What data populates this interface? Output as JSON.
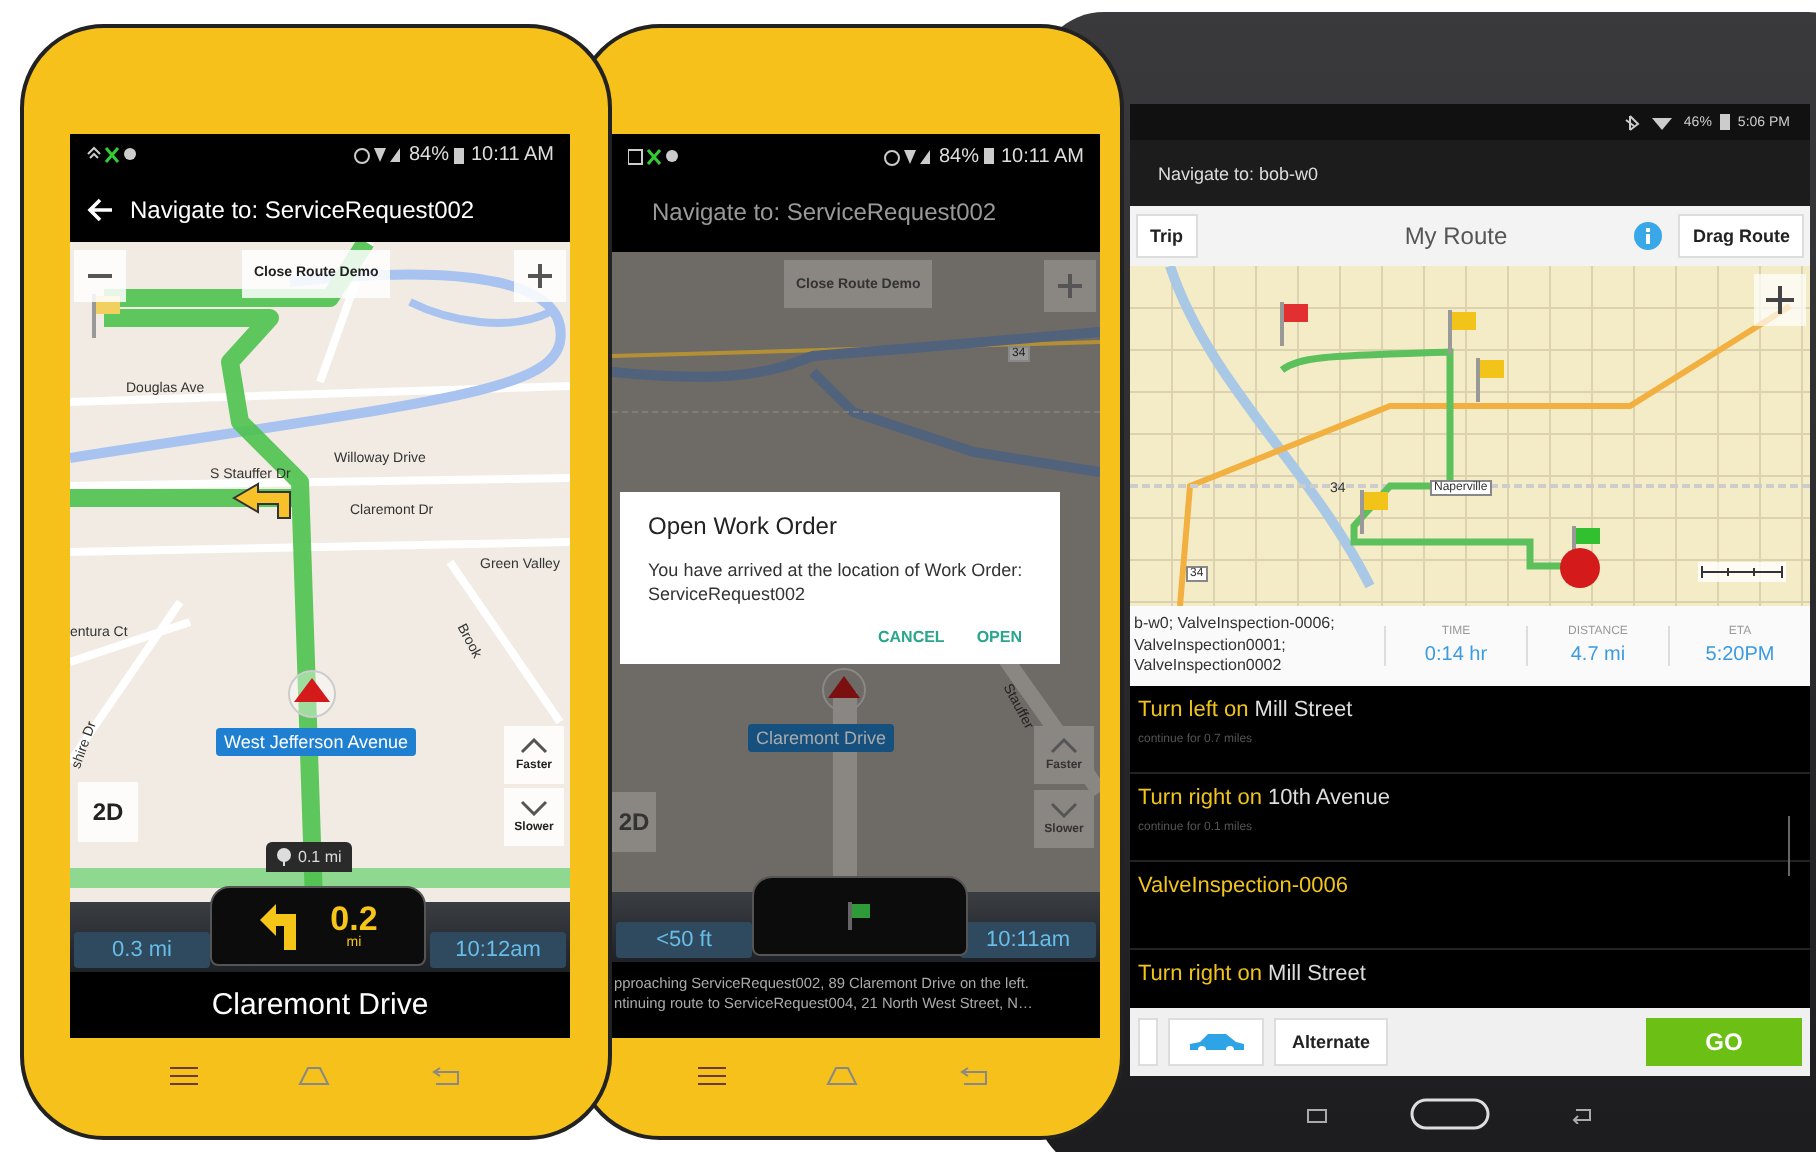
{
  "phone_navigation": {
    "status": {
      "battery": "84%",
      "time": "10:11 AM"
    },
    "title": "Navigate to: ServiceRequest002",
    "map": {
      "close_button": "Close Route Demo",
      "labels": [
        "Douglas Ave",
        "Willoway Drive",
        "S Stauffer Dr",
        "Claremont Dr",
        "Green Valley",
        "entura Ct",
        "Brook",
        "shire Dr"
      ],
      "vehicle_label": "West Jefferson Avenue",
      "speed_buttons": [
        "Faster",
        "Slower"
      ],
      "view_button": "2D",
      "distance_tag": "0.1 mi"
    },
    "dashboard": {
      "left": "0.3 mi",
      "turn_distance": "0.2",
      "turn_unit": "mi",
      "right": "10:12am"
    },
    "street": "Claremont Drive"
  },
  "phone_arrival": {
    "status": {
      "battery": "84%",
      "time": "10:11 AM"
    },
    "title": "Navigate to: ServiceRequest002",
    "map": {
      "close_button": "Close Route Demo",
      "labels": [
        "34",
        "Stauffer"
      ],
      "vehicle_label": "Claremont Drive",
      "speed_buttons": [
        "Faster",
        "Slower"
      ],
      "view_button": "2D"
    },
    "dialog": {
      "title": "Open Work Order",
      "message": "You have arrived at the location of Work Order: ServiceRequest002",
      "buttons": [
        "CANCEL",
        "OPEN"
      ]
    },
    "dashboard": {
      "left": "<50 ft",
      "right": "10:11am"
    },
    "messages": [
      "pproaching ServiceRequest002, 89 Claremont Drive on the left.",
      "ntinuing route to ServiceRequest004, 21 North West Street, N…"
    ]
  },
  "tablet": {
    "status": {
      "battery": "46%",
      "time": "5:06 PM"
    },
    "title": "Navigate to: bob-w0",
    "toolbar": {
      "left_button": "Trip",
      "title": "My Route",
      "right_button": "Drag Route"
    },
    "map": {
      "labels": [
        "34",
        "Naperville",
        "34"
      ]
    },
    "stops": "b-w0; ValveInspection-0006;\nValveInspection0001;\nValveInspection0002",
    "stats": [
      {
        "label": "TIME",
        "value": "0:14 hr"
      },
      {
        "label": "DISTANCE",
        "value": "4.7 mi"
      },
      {
        "label": "ETA",
        "value": "5:20PM"
      }
    ],
    "directions": [
      {
        "kind": "turn",
        "action": "Turn left on",
        "street": "Mill Street",
        "note": "continue for 0.7 miles"
      },
      {
        "kind": "turn",
        "action": "Turn right on",
        "street": "10th Avenue",
        "note": "continue for 0.1 miles"
      },
      {
        "kind": "stop",
        "name": "ValveInspection-0006"
      },
      {
        "kind": "turn",
        "action": "Turn right on",
        "street": "Mill Street"
      }
    ],
    "buttons": {
      "alternate": "Alternate",
      "go": "GO"
    }
  }
}
